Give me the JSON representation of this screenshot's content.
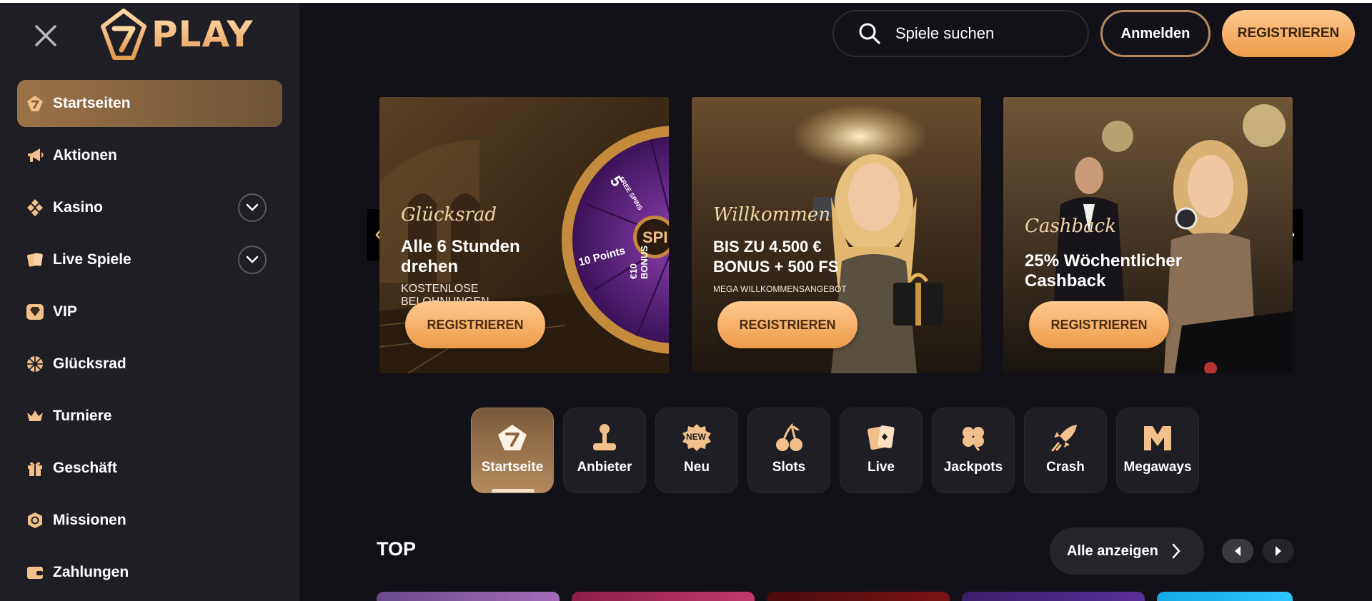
{
  "brand": {
    "name": "PLAY",
    "accent": "#f0a35a",
    "background": "#121117",
    "sidebar_bg": "#1f1e25"
  },
  "sidebar": {
    "items": [
      {
        "label": "Startseiten",
        "icon": "home-logo-icon",
        "active": true
      },
      {
        "label": "Aktionen",
        "icon": "megaphone-icon"
      },
      {
        "label": "Kasino",
        "icon": "diamonds-icon",
        "expandable": true
      },
      {
        "label": "Live Spiele",
        "icon": "cards-icon",
        "expandable": true
      },
      {
        "label": "VIP",
        "icon": "diamond-icon"
      },
      {
        "label": "Glücksrad",
        "icon": "wheel-icon"
      },
      {
        "label": "Turniere",
        "icon": "crown-icon"
      },
      {
        "label": "Geschäft",
        "icon": "gift-icon"
      },
      {
        "label": "Missionen",
        "icon": "mission-icon"
      },
      {
        "label": "Zahlungen",
        "icon": "wallet-icon"
      }
    ]
  },
  "header": {
    "search_placeholder": "Spiele suchen",
    "login_label": "Anmelden",
    "register_label": "REGISTRIEREN"
  },
  "banners": [
    {
      "script": "Glücksrad",
      "headline": "Alle 6 Stunden drehen",
      "sub": "KOSTENLOSE BELOHNUNGEN",
      "cta": "REGISTRIEREN",
      "wheel": {
        "label_free_spins_num": "5",
        "label_free_spins": "FREE SPINS",
        "label_points": "10 Points",
        "label_bonus": "€10 BONUS",
        "label_center": "SPI"
      }
    },
    {
      "script": "Willkommen",
      "headline": "BIS ZU 4.500 € BONUS + 500 FS",
      "sub": "MEGA WILLKOMMENSANGEBOT",
      "cta": "REGISTRIEREN"
    },
    {
      "script": "Cashback",
      "headline": "25% Wöchentlicher Cashback",
      "sub": "",
      "cta": "REGISTRIEREN"
    }
  ],
  "categories": [
    {
      "label": "Startseite",
      "icon": "home-logo-icon",
      "active": true
    },
    {
      "label": "Anbieter",
      "icon": "joystick-icon"
    },
    {
      "label": "Neu",
      "icon": "new-badge-icon",
      "badge": "NEW"
    },
    {
      "label": "Slots",
      "icon": "cherries-icon"
    },
    {
      "label": "Live",
      "icon": "cards-icon"
    },
    {
      "label": "Jackpots",
      "icon": "clover-icon"
    },
    {
      "label": "Crash",
      "icon": "rocket-icon"
    },
    {
      "label": "Megaways",
      "icon": "megaways-icon",
      "badge": "M"
    }
  ],
  "top_section": {
    "title": "TOP",
    "view_all": "Alle anzeigen"
  }
}
